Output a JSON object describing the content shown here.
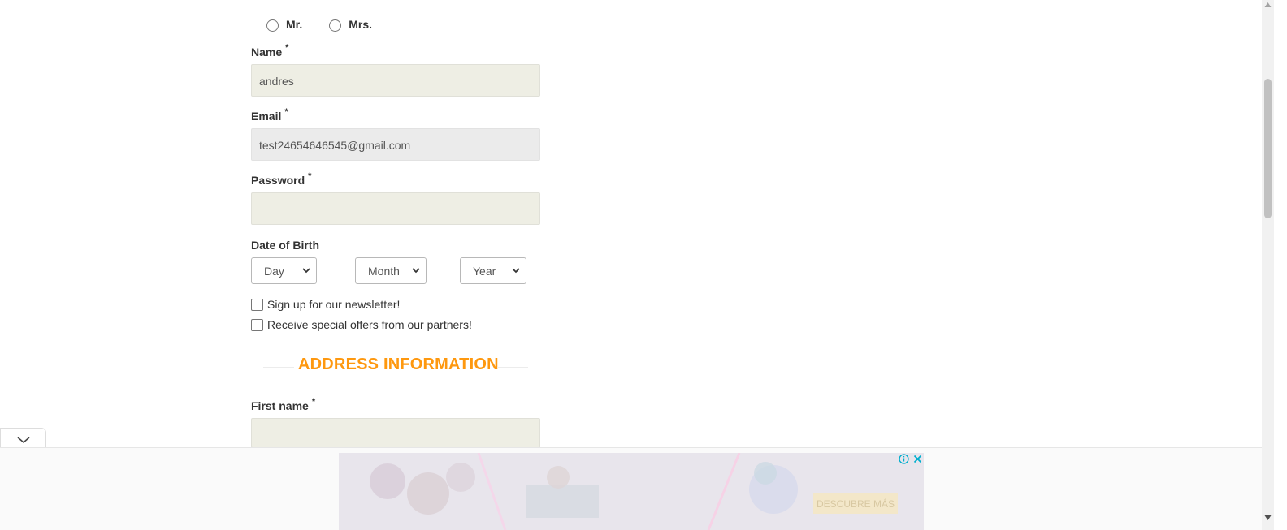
{
  "title_options": [
    {
      "label": "Mr."
    },
    {
      "label": "Mrs."
    }
  ],
  "form": {
    "name": {
      "label": "Name",
      "required_mark": "*",
      "value": "andres"
    },
    "email": {
      "label": "Email",
      "required_mark": "*",
      "value": "test24654646545@gmail.com"
    },
    "password": {
      "label": "Password",
      "required_mark": "*",
      "value": ""
    },
    "dob": {
      "label": "Date of Birth",
      "day": "Day",
      "month": "Month",
      "year": "Year"
    },
    "newsletter": "Sign up for our newsletter!",
    "offers": "Receive special offers from our partners!"
  },
  "address_section": {
    "title": "ADDRESS INFORMATION",
    "first_name": {
      "label": "First name",
      "required_mark": "*",
      "value": ""
    }
  },
  "ad": {
    "cta": "DESCUBRE MÁS",
    "info_icon": "info-icon",
    "close_icon": "close-icon"
  },
  "colors": {
    "accent": "#fe980f",
    "input_bg": "#eeeee4"
  }
}
